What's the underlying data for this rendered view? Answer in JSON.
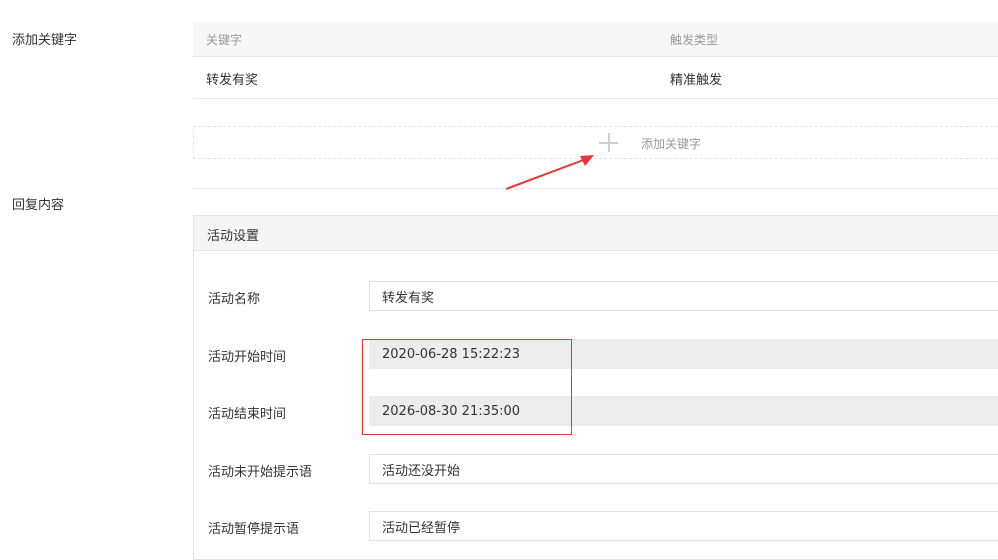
{
  "keyword_section": {
    "label": "添加关键字",
    "table": {
      "headers": [
        "关键字",
        "触发类型"
      ],
      "rows": [
        [
          "转发有奖",
          "精准触发"
        ]
      ]
    },
    "add_button_label": "添加关键字"
  },
  "reply_section": {
    "label": "回复内容"
  },
  "activity_panel": {
    "title": "活动设置",
    "fields": [
      {
        "label": "活动名称",
        "value": "转发有奖",
        "readonly": false
      },
      {
        "label": "活动开始时间",
        "value": "2020-06-28 15:22:23",
        "readonly": true
      },
      {
        "label": "活动结束时间",
        "value": "2026-08-30 21:35:00",
        "readonly": true
      },
      {
        "label": "活动未开始提示语",
        "value": "活动还没开始",
        "readonly": false
      },
      {
        "label": "活动暂停提示语",
        "value": "活动已经暂停",
        "readonly": false
      }
    ]
  },
  "annotation": {
    "arrow_color": "#e53935",
    "box_color": "#e53935"
  }
}
